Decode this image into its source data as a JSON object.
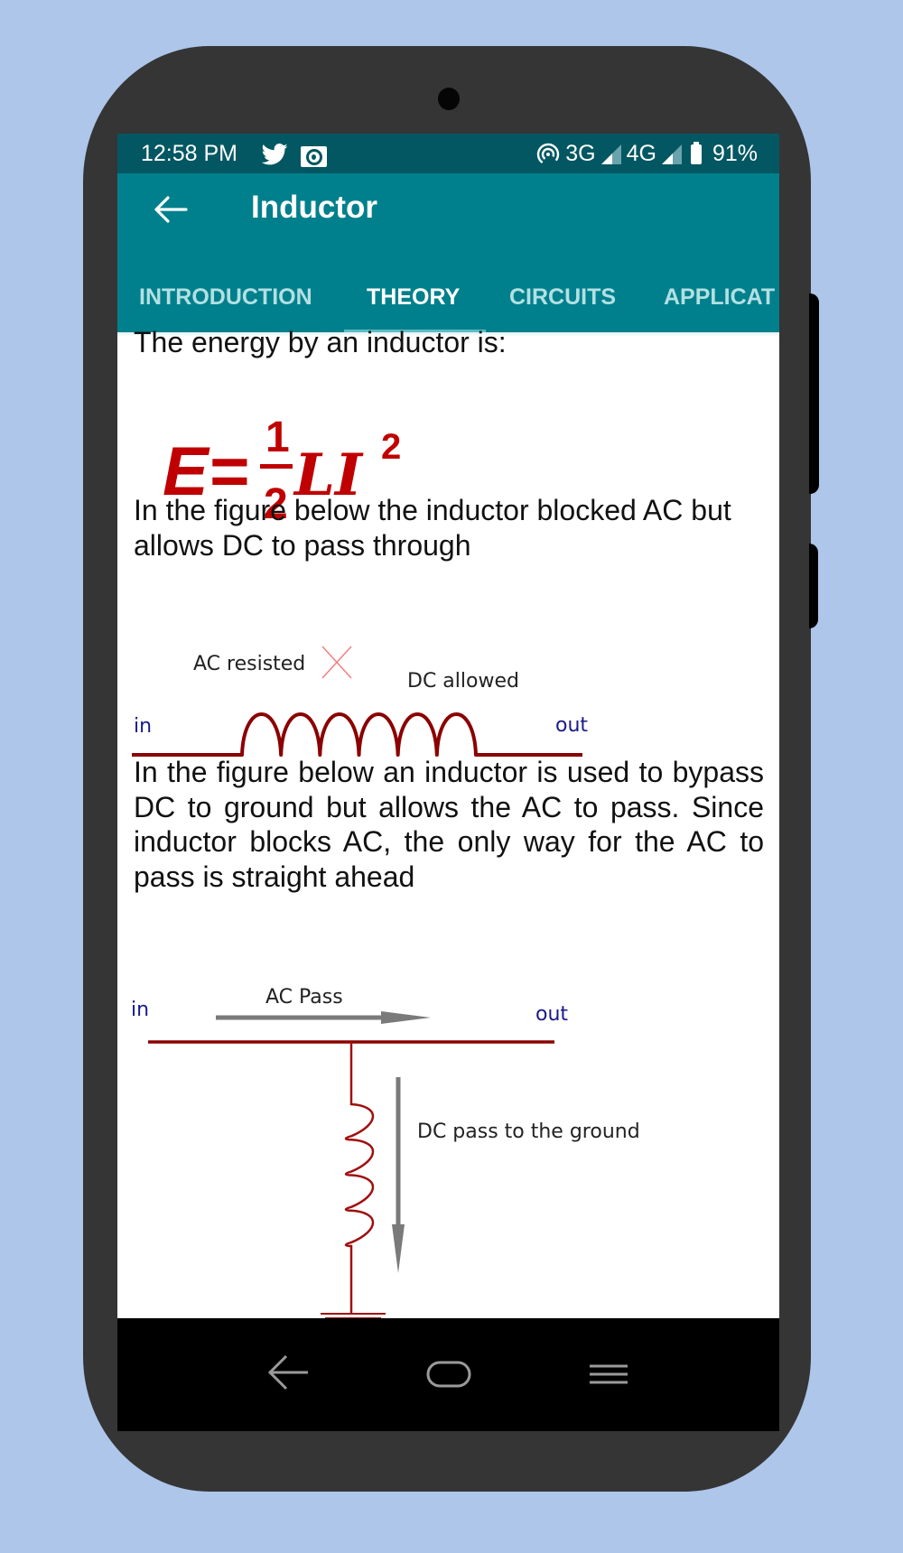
{
  "status_bar": {
    "time": "12:58 PM",
    "left_icons": [
      "twitter-icon",
      "notification-app-icon"
    ],
    "right_icons": [
      "hotspot-icon",
      "signal-icon",
      "signal-icon",
      "battery-icon"
    ],
    "network_1": "3G",
    "network_2": "4G",
    "battery": "91%"
  },
  "toolbar": {
    "back_icon": "arrow-left-icon",
    "title": "Inductor"
  },
  "tabs": [
    {
      "label": "INTRODUCTION",
      "active": false
    },
    {
      "label": "THEORY",
      "active": true
    },
    {
      "label": "CIRCUITS",
      "active": false
    },
    {
      "label": "APPLICAT",
      "active": false
    }
  ],
  "content": {
    "p1": "The energy by an inductor is:",
    "formula": {
      "lhs": "E=",
      "numerator": "1",
      "denominator": "2",
      "rhs": "LI",
      "exponent": "2",
      "color": "#c00000"
    },
    "p2": "In the figure below the inductor blocked AC but allows DC to pass through",
    "diagram1": {
      "label_in": "in",
      "label_out": "out",
      "label_ac": "AC resisted",
      "label_dc": "DC allowed",
      "coil_turns": 6
    },
    "p3": "In the figure below an inductor is used to bypass DC to ground but allows the AC to pass. Since inductor blocks AC, the only way for the AC to pass is straight ahead",
    "diagram2": {
      "label_in": "in",
      "label_out": "out",
      "label_ac": "AC Pass",
      "label_dc": "DC pass to the ground",
      "coil_turns": 4
    }
  },
  "nav_bar": {
    "back": "nav-back-icon",
    "home": "nav-home-icon",
    "recents": "nav-menu-icon"
  },
  "colors": {
    "background": "#aec6ea",
    "phone_body": "#353535",
    "status_bar": "#025762",
    "toolbar": "#00808c",
    "tab_indicator": "#5fbdc5",
    "wire": "#8b0000",
    "label_blue": "#1a1a8c",
    "arrow_gray": "#7a7a7a"
  }
}
